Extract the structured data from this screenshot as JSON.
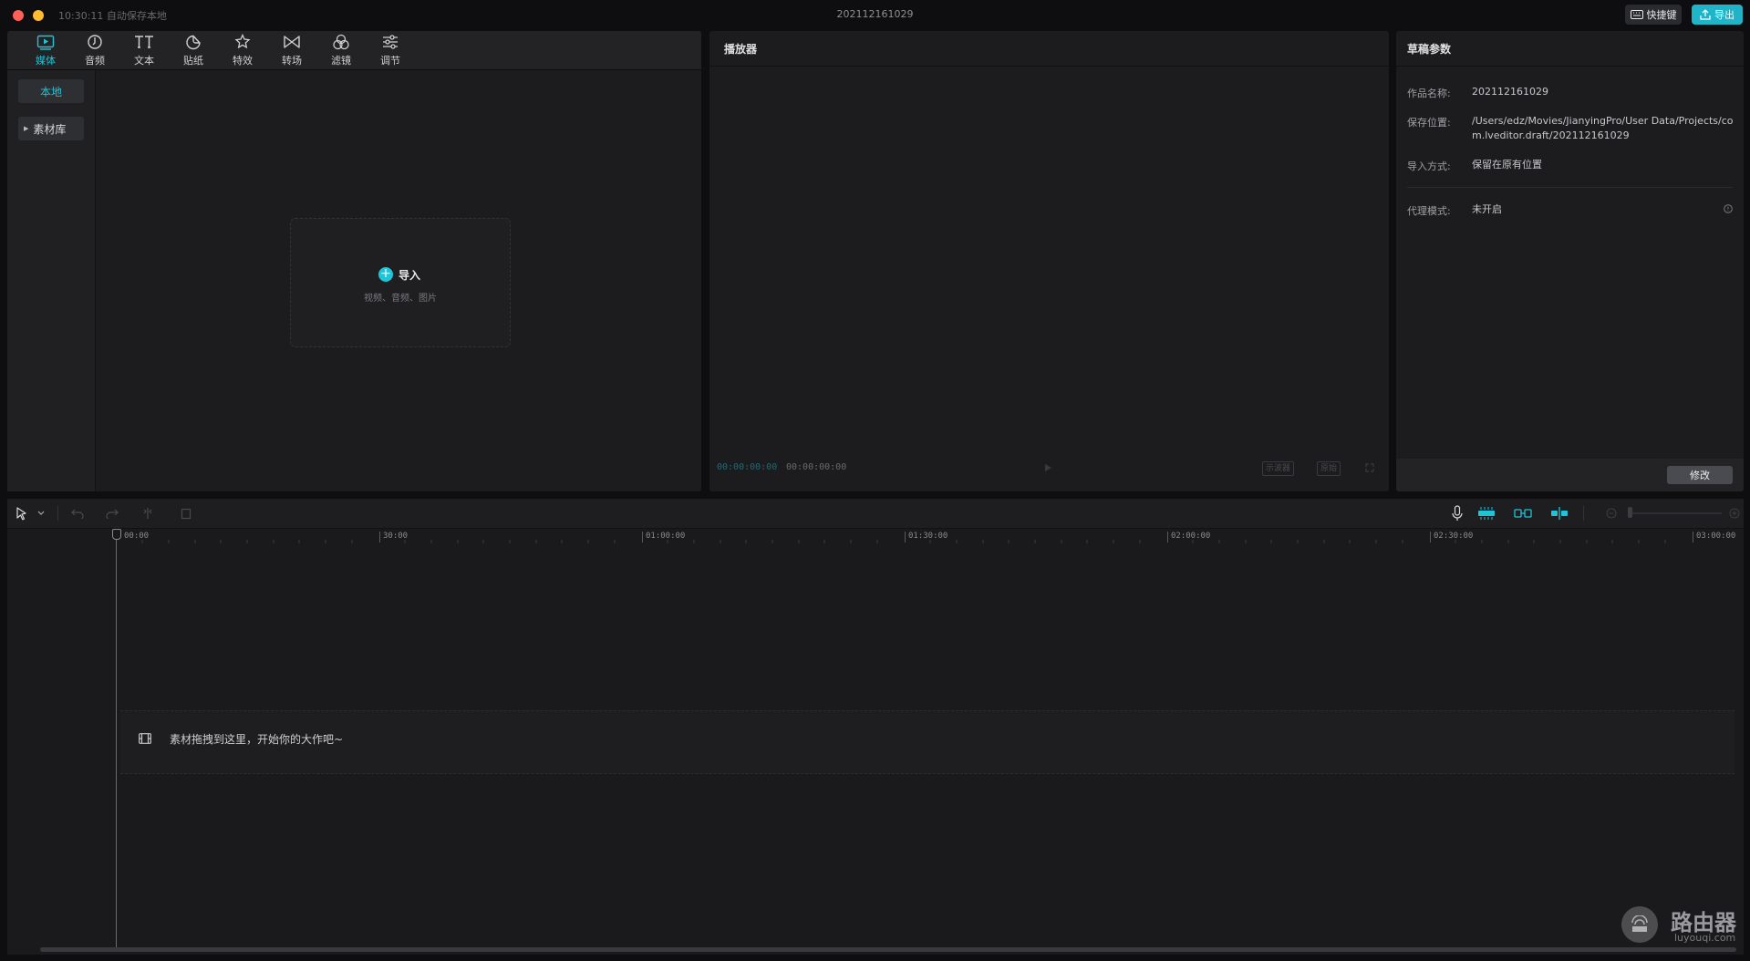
{
  "titlebar": {
    "autosave_text": "10:30:11 自动保存本地",
    "window_title": "202112161029",
    "shortcut_label": "快捷键",
    "export_label": "导出"
  },
  "media": {
    "tabs": [
      {
        "label": "媒体",
        "icon": "media-icon"
      },
      {
        "label": "音频",
        "icon": "audio-icon"
      },
      {
        "label": "文本",
        "icon": "text-icon"
      },
      {
        "label": "贴纸",
        "icon": "sticker-icon"
      },
      {
        "label": "特效",
        "icon": "effects-icon"
      },
      {
        "label": "转场",
        "icon": "transition-icon"
      },
      {
        "label": "滤镜",
        "icon": "filter-icon"
      },
      {
        "label": "调节",
        "icon": "adjust-icon"
      }
    ],
    "sidebar": {
      "local_label": "本地",
      "library_label": "素材库"
    },
    "import": {
      "label": "导入",
      "sub": "视频、音频、图片"
    }
  },
  "player": {
    "title": "播放器",
    "time_current": "00:00:00:00",
    "time_total": "00:00:00:00",
    "scope_label": "示波器",
    "ratio_label": "原始"
  },
  "draft": {
    "title": "草稿参数",
    "name_label": "作品名称:",
    "name_value": "202112161029",
    "path_label": "保存位置:",
    "path_value": "/Users/edz/Movies/JianyingPro/User Data/Projects/com.lveditor.draft/202112161029",
    "import_label": "导入方式:",
    "import_value": "保留在原有位置",
    "proxy_label": "代理模式:",
    "proxy_value": "未开启",
    "modify_label": "修改"
  },
  "timeline": {
    "ticks": [
      "00:00",
      "30:00",
      "01:00:00",
      "01:30:00",
      "02:00:00",
      "02:30:00",
      "03:00:00"
    ],
    "drop_text": "素材拖拽到这里，开始你的大作吧~"
  },
  "watermark": {
    "title": "路由器",
    "sub": "luyouqi.com"
  },
  "colors": {
    "accent": "#1fc4d6",
    "export": "#1fb4c8",
    "close": "#fe5f57",
    "minimize": "#febc2e"
  }
}
